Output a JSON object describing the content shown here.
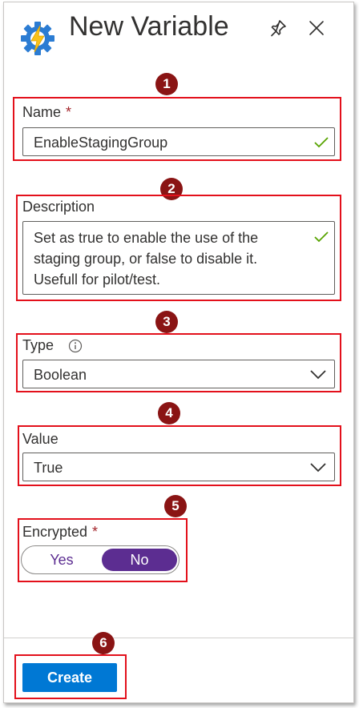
{
  "header": {
    "title": "New Variable",
    "icon": "automation-gear-bolt-icon",
    "pin_icon": "pin-icon",
    "close_icon": "close-icon"
  },
  "annotations": [
    "1",
    "2",
    "3",
    "4",
    "5",
    "6"
  ],
  "form": {
    "name": {
      "label": "Name",
      "required_marker": "*",
      "value": "EnableStagingGroup",
      "valid": true
    },
    "description": {
      "label": "Description",
      "lines": [
        "Set as true to enable the use of the",
        "staging group, or false to disable it.",
        "Usefull for pilot/test."
      ],
      "valid": true
    },
    "type": {
      "label": "Type",
      "info_icon": "info-icon",
      "value": "Boolean"
    },
    "value": {
      "label": "Value",
      "value": "True"
    },
    "encrypted": {
      "label": "Encrypted",
      "required_marker": "*",
      "options": [
        "Yes",
        "No"
      ],
      "selected": "No"
    }
  },
  "footer": {
    "create_label": "Create"
  },
  "colors": {
    "accent_purple": "#5c2d91",
    "primary_blue": "#0078d4",
    "annotation_red": "#e3101b",
    "badge_red": "#8a1414",
    "valid_green": "#57a300"
  }
}
